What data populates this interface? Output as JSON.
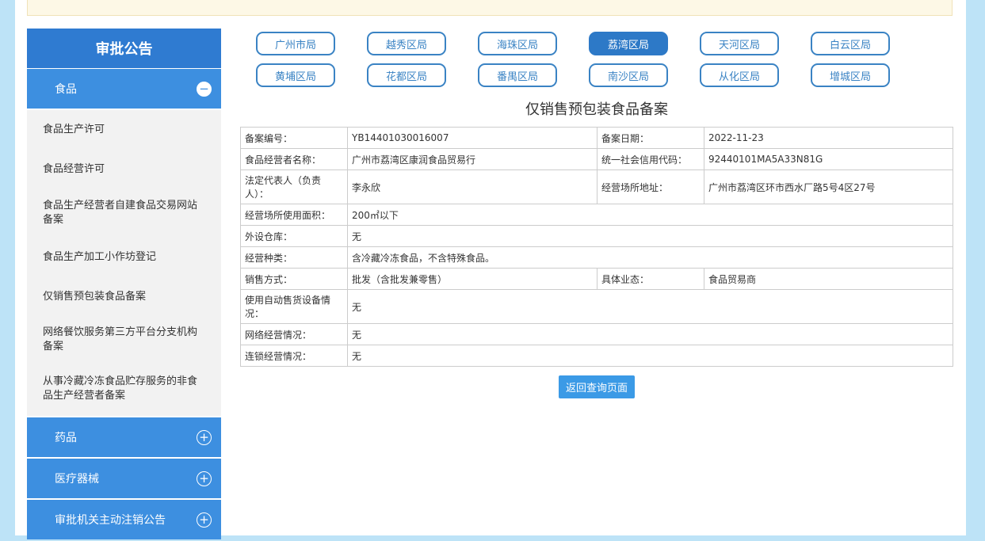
{
  "sidebar": {
    "title": "审批公告",
    "food": {
      "label": "食品",
      "toggle": "−"
    },
    "food_items": [
      "食品生产许可",
      "食品经营许可",
      "食品生产经营者自建食品交易网站备案",
      "食品生产加工小作坊登记",
      "仅销售预包装食品备案",
      "网络餐饮服务第三方平台分支机构备案",
      "从事冷藏冷冻食品贮存服务的非食品生产经营者备案"
    ],
    "drug": {
      "label": "药品",
      "toggle": "+"
    },
    "device": {
      "label": "医疗器械",
      "toggle": "+"
    },
    "cancel": {
      "label": "审批机关主动注销公告",
      "toggle": "+"
    }
  },
  "districts": [
    "广州市局",
    "越秀区局",
    "海珠区局",
    "荔湾区局",
    "天河区局",
    "白云区局",
    "黄埔区局",
    "花都区局",
    "番禺区局",
    "南沙区局",
    "从化区局",
    "增城区局"
  ],
  "active_district": "荔湾区局",
  "record": {
    "title": "仅销售预包装食品备案",
    "rows": {
      "r1": {
        "l1": "备案编号：",
        "v1": "YB14401030016007",
        "l2": "备案日期：",
        "v2": "2022-11-23"
      },
      "r2": {
        "l1": "食品经营者名称：",
        "v1": "广州市荔湾区康润食品贸易行",
        "l2": "统一社会信用代码：",
        "v2": "92440101MA5A33N81G"
      },
      "r3": {
        "l1": "法定代表人（负责人）：",
        "v1": "李永欣",
        "l2": "经营场所地址：",
        "v2": "广州市荔湾区环市西水厂路5号4区27号"
      },
      "r4": {
        "l1": "经营场所使用面积：",
        "v1": "200㎡以下"
      },
      "r5": {
        "l1": "外设仓库：",
        "v1": "无"
      },
      "r6": {
        "l1": "经营种类：",
        "v1": "含冷藏冷冻食品，不含特殊食品。"
      },
      "r7": {
        "l1": "销售方式：",
        "v1": "批发（含批发兼零售）",
        "l2": "具体业态：",
        "v2": "食品贸易商"
      },
      "r8": {
        "l1": "使用自动售货设备情况：",
        "v1": "无"
      },
      "r9": {
        "l1": "网络经营情况：",
        "v1": "无"
      },
      "r10": {
        "l1": "连锁经营情况：",
        "v1": "无"
      }
    }
  },
  "back_button": "返回查询页面"
}
